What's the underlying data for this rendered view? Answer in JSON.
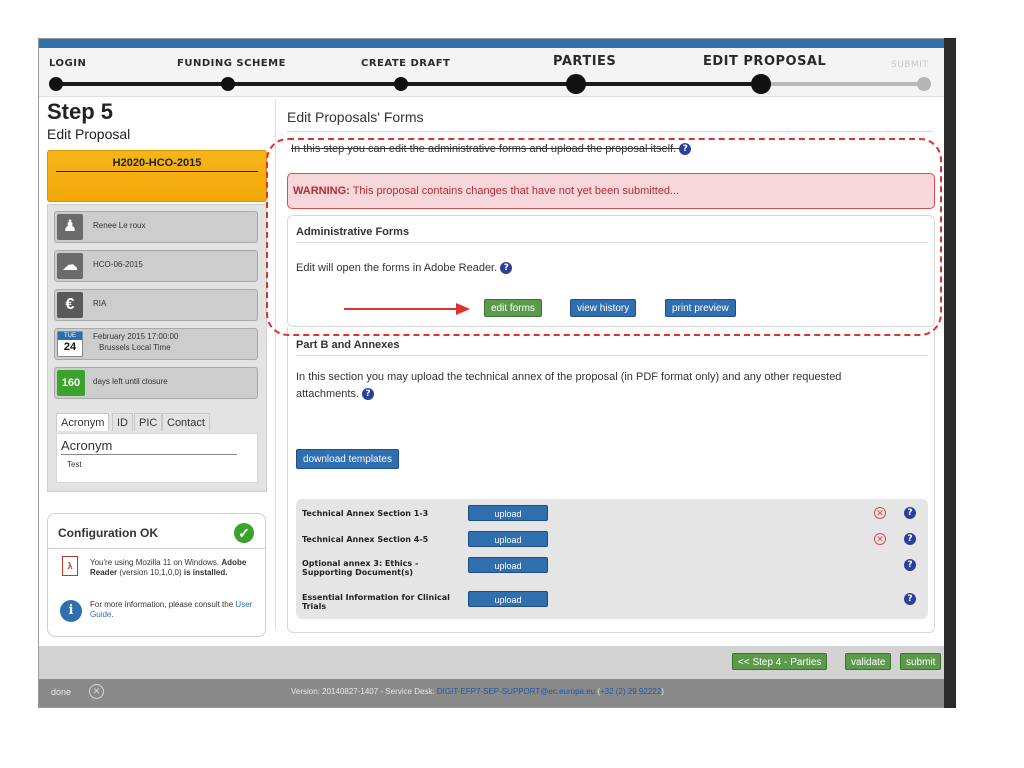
{
  "wizard": {
    "steps": [
      "LOGIN",
      "FUNDING SCHEME",
      "CREATE DRAFT",
      "PARTIES",
      "EDIT PROPOSAL",
      "SUBMIT"
    ]
  },
  "left": {
    "step_number": "Step 5",
    "step_name": "Edit Proposal",
    "project_code": "H2020-HCO-2015",
    "info": {
      "person": "Renee Le roux",
      "call": "HCO-06-2015",
      "type": "RIA",
      "deadline_day": "24",
      "deadline_dow": "TUE",
      "deadline_line1": "February 2015  17:00:00",
      "deadline_line2": "Brussels Local Time",
      "days_left": "160",
      "days_left_label": "days left until closure"
    },
    "tabs": [
      "Acronym",
      "ID",
      "PIC",
      "Contact"
    ],
    "tab_heading": "Acronym",
    "tab_value": "Test"
  },
  "config": {
    "title": "Configuration OK",
    "reader_text_1": "You're using Mozilla 11 on Windows.",
    "reader_bold": "Adobe Reader",
    "reader_text_2": "(version 10,1,0,0)",
    "reader_installed": "is installed",
    "more_info": "For more information, please consult the",
    "guide_link": "User Guide"
  },
  "main": {
    "title": "Edit Proposals' Forms",
    "intro": "In this step you can edit the administrative forms and upload the proposal itself.",
    "warning_label": "WARNING:",
    "warning_text": "This proposal contains changes that have not yet been submitted...",
    "admin": {
      "heading": "Administrative Forms",
      "text": "Edit will open the forms in Adobe Reader.",
      "edit_btn": "edit forms",
      "history_btn": "view history",
      "preview_btn": "print preview"
    },
    "partb": {
      "heading": "Part B and Annexes",
      "text_1": "In this section you may upload the technical annex of the proposal (in PDF format only) and any other requested",
      "text_2": "attachments.",
      "download_btn": "download templates",
      "attachments": [
        {
          "name": "Technical Annex Section 1-3",
          "upload": "upload"
        },
        {
          "name": "Technical Annex Section 4-5",
          "upload": "upload"
        },
        {
          "name": "Optional annex 3: Ethics - Supporting Document(s)",
          "upload": "upload"
        },
        {
          "name": "Essential Information for Clinical Trials",
          "upload": "upload"
        }
      ]
    }
  },
  "actions": {
    "prev": "<< Step 4 - Parties",
    "validate": "validate",
    "submit": "submit"
  },
  "status": {
    "done": "done",
    "version": "Version: 20140827-1407 - Service Desk:",
    "email": "DIGIT-EFP7-SEP-SUPPORT@ec.europa.eu",
    "phone": "+32 (2) 29 92222",
    "close_paren": ")"
  },
  "colors": {
    "accent": "#2f6fb0",
    "warning_bg": "#f7d7da",
    "warning_text": "#b52b34",
    "project_card": "#f2a708",
    "action_green": "#5b9a4b",
    "annotation_red": "#e03030"
  },
  "icons": [
    "person-icon",
    "cloud-icon",
    "euro-icon",
    "calendar-icon",
    "pdf-icon",
    "info-icon",
    "check-icon",
    "help-icon",
    "delete-icon",
    "close-icon"
  ]
}
